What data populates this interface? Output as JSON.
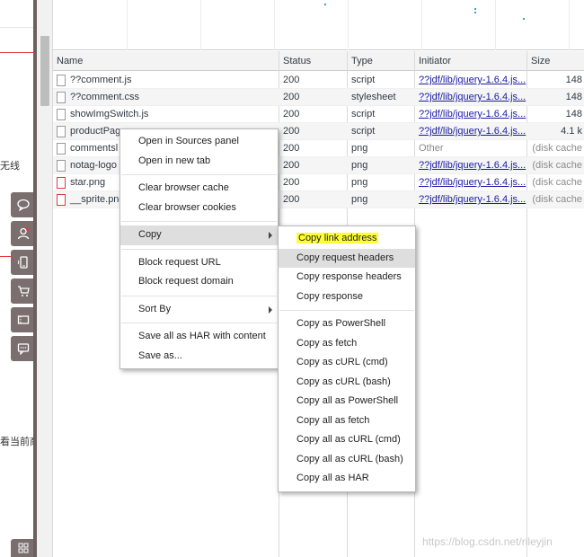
{
  "page_strip": {
    "fragment_1": "无线",
    "fragment_2": "看当前商"
  },
  "toolbar_icons": [
    "chat-bubble-icon",
    "user-icon",
    "mobile-icon",
    "cart-icon",
    "ticket-icon",
    "message-icon"
  ],
  "bottom_icon": "grid-icon",
  "network": {
    "columns": {
      "name": "Name",
      "status": "Status",
      "type": "Type",
      "initiator": "Initiator",
      "size": "Size"
    },
    "rows": [
      {
        "name": "??comment.js",
        "status": "200",
        "type": "script",
        "initiator": "??jdf/lib/jquery-1.6.4.js...",
        "size": "148"
      },
      {
        "name": "??comment.css",
        "status": "200",
        "type": "stylesheet",
        "initiator": "??jdf/lib/jquery-1.6.4.js...",
        "size": "148"
      },
      {
        "name": "showImgSwitch.js",
        "status": "200",
        "type": "script",
        "initiator": "??jdf/lib/jquery-1.6.4.js...",
        "size": "148"
      },
      {
        "name": "productPag",
        "status": "200",
        "type": "script",
        "initiator": "??jdf/lib/jquery-1.6.4.js...",
        "size": "4.1 k"
      },
      {
        "name": "commentsl",
        "status": "200",
        "type": "png",
        "initiator": "Other",
        "size": "(disk cache"
      },
      {
        "name": "notag-logo",
        "status": "200",
        "type": "png",
        "initiator": "??jdf/lib/jquery-1.6.4.js...",
        "size": "(disk cache"
      },
      {
        "name": "star.png",
        "status": "200",
        "type": "png",
        "initiator": "??jdf/lib/jquery-1.6.4.js...",
        "size": "(disk cache"
      },
      {
        "name": "__sprite.png",
        "status": "200",
        "type": "png",
        "initiator": "??jdf/lib/jquery-1.6.4.js...",
        "size": "(disk cache"
      }
    ]
  },
  "context_menu": {
    "open_in_sources": "Open in Sources panel",
    "open_new_tab": "Open in new tab",
    "clear_cache": "Clear browser cache",
    "clear_cookies": "Clear browser cookies",
    "copy": "Copy",
    "block_url": "Block request URL",
    "block_domain": "Block request domain",
    "sort_by": "Sort By",
    "save_har": "Save all as HAR with content",
    "save_as": "Save as..."
  },
  "copy_submenu": {
    "copy_link": "Copy link address",
    "copy_req_headers": "Copy request headers",
    "copy_resp_headers": "Copy response headers",
    "copy_response": "Copy response",
    "copy_powershell": "Copy as PowerShell",
    "copy_fetch": "Copy as fetch",
    "copy_curl_cmd": "Copy as cURL (cmd)",
    "copy_curl_bash": "Copy as cURL (bash)",
    "copy_all_powershell": "Copy all as PowerShell",
    "copy_all_fetch": "Copy all as fetch",
    "copy_all_curl_cmd": "Copy all as cURL (cmd)",
    "copy_all_curl_bash": "Copy all as cURL (bash)",
    "copy_all_har": "Copy all as HAR"
  },
  "watermark": "https://blog.csdn.net/rileyjin",
  "colors": {
    "highlight_marker": "#ffff33",
    "initiator_link": "#1a1aa6",
    "menu_hover": "#dedede",
    "toolbar_button": "#7a6e6e"
  }
}
